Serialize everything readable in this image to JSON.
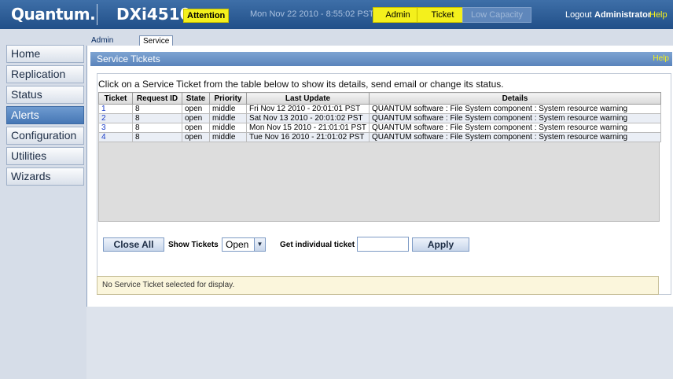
{
  "header": {
    "brand": "Quantum.",
    "product": "DXi4510",
    "attention": "Attention",
    "datetime": "Mon Nov 22 2010 - 8:55:02 PST",
    "admin_label": "Admin",
    "ticket_label": "Ticket",
    "low_capacity_label": "Low Capacity",
    "logout_label": "Logout",
    "user": "Administrator",
    "help_label": "Help"
  },
  "subtabs": [
    "Admin Alerts",
    "Service Tickets"
  ],
  "sidebar": {
    "items": [
      {
        "label": "Home"
      },
      {
        "label": "Replication"
      },
      {
        "label": "Status"
      },
      {
        "label": "Alerts"
      },
      {
        "label": "Configuration"
      },
      {
        "label": "Utilities"
      },
      {
        "label": "Wizards"
      }
    ]
  },
  "panel": {
    "title": "Service Tickets",
    "help": "Help",
    "instruction": "Click on a Service Ticket from the table below to show its details, send email or change its status."
  },
  "table": {
    "columns": [
      "Ticket",
      "Request ID",
      "State",
      "Priority",
      "Last Update",
      "Details"
    ],
    "rows": [
      {
        "ticket": "1",
        "request_id": "8",
        "state": "open",
        "priority": "middle",
        "last_update": "Fri Nov 12 2010 - 20:01:01 PST",
        "details": "QUANTUM software : File System component : System resource warning"
      },
      {
        "ticket": "2",
        "request_id": "8",
        "state": "open",
        "priority": "middle",
        "last_update": "Sat Nov 13 2010 - 20:01:02 PST",
        "details": "QUANTUM software : File System component : System resource warning"
      },
      {
        "ticket": "3",
        "request_id": "8",
        "state": "open",
        "priority": "middle",
        "last_update": "Mon Nov 15 2010 - 21:01:01 PST",
        "details": "QUANTUM software : File System component : System resource warning"
      },
      {
        "ticket": "4",
        "request_id": "8",
        "state": "open",
        "priority": "middle",
        "last_update": "Tue Nov 16 2010 - 21:01:02 PST",
        "details": "QUANTUM software : File System component : System resource warning"
      }
    ]
  },
  "controls": {
    "close_all": "Close All",
    "show_tickets_label": "Show Tickets",
    "show_tickets_value": "Open",
    "get_ticket_label": "Get individual ticket",
    "get_ticket_value": "",
    "apply": "Apply"
  },
  "status_message": "No Service Ticket selected for display.",
  "colors": {
    "header_blue": "#2d5c96",
    "alert_yellow": "#f4f01c",
    "active_nav": "#4677b5",
    "ticket_link": "#1a3cc8"
  }
}
